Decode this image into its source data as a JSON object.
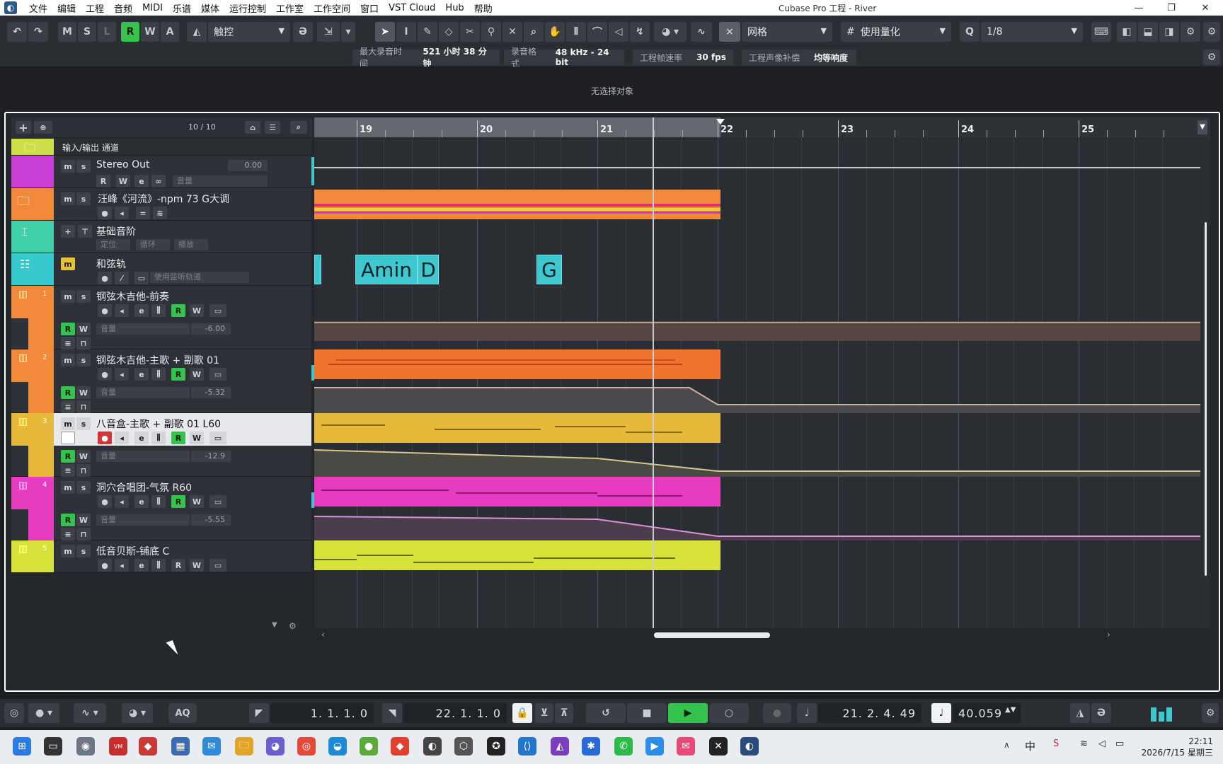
{
  "window": {
    "title": "Cubase Pro 工程 - River"
  },
  "menu": [
    "文件",
    "编辑",
    "工程",
    "音频",
    "MIDI",
    "乐谱",
    "媒体",
    "运行控制",
    "工作室",
    "工作空间",
    "窗口",
    "VST Cloud",
    "Hub",
    "帮助"
  ],
  "toolbar": {
    "state_buttons": [
      "M",
      "S",
      "L",
      "R",
      "W",
      "A"
    ],
    "automation_mode": "触控",
    "snap_type": "网格",
    "quantize_mode": "使用量化",
    "quantize_value": "1/8"
  },
  "info": {
    "max_rec_label": "最大录音时间",
    "max_rec_value": "521 小时 38 分钟",
    "rec_format_label": "录音格式",
    "rec_format_value": "48 kHz - 24 bit",
    "frame_rate_label": "工程帧速率",
    "frame_rate_value": "30 fps",
    "pan_law_label": "工程声像补偿",
    "pan_law_value": "均等响度"
  },
  "status": "无选择对象",
  "tracklist": {
    "count": "10 / 10",
    "tracks": [
      {
        "name": "输入/输出 通道",
        "color": "#cde04a"
      },
      {
        "name": "Stereo Out",
        "value": "0.00",
        "field": "音量",
        "color": "#c93fd6"
      },
      {
        "name": "汪峰《河流》-npm 73 G大调",
        "color": "#f08a3a"
      },
      {
        "name": "基础音阶",
        "fields": [
          "定位",
          "循环",
          "播放"
        ],
        "color": "#3fd0a8"
      },
      {
        "name": "和弦轨",
        "field": "使用监听轨道",
        "color": "#38c8d0"
      },
      {
        "name": "钢弦木吉他-前奏",
        "num": "1",
        "vol_label": "音量",
        "vol": "-6.00",
        "color": "#f08a3a"
      },
      {
        "name": "钢弦木吉他-主歌 + 副歌 01",
        "num": "2",
        "vol_label": "音量",
        "vol": "-5.32",
        "color": "#f08a3a"
      },
      {
        "name": "八音盒-主歌 + 副歌 01 L60",
        "num": "3",
        "vol_label": "音量",
        "vol": "-12.9",
        "color": "#e6b93a"
      },
      {
        "name": "洞穴合唱团-气氛 R60",
        "num": "4",
        "vol_label": "音量",
        "vol": "-5.55",
        "color": "#e83cc0"
      },
      {
        "name": "低音贝斯-铺底 C",
        "num": "5",
        "color": "#d7e23a"
      }
    ]
  },
  "ruler": {
    "bars": [
      "19",
      "20",
      "21",
      "22",
      "23",
      "24",
      "25"
    ]
  },
  "chords": [
    "Amin",
    "D",
    "G"
  ],
  "transport": {
    "left_locator": "1. 1. 1. 0",
    "right_locator": "22. 1. 1. 0",
    "position": "21. 2. 4. 49",
    "tempo": "40.059",
    "aq": "AQ"
  },
  "clock": {
    "time": "22:11",
    "date": "2026/7/15 星期三"
  },
  "tray": {
    "ime": "中"
  }
}
